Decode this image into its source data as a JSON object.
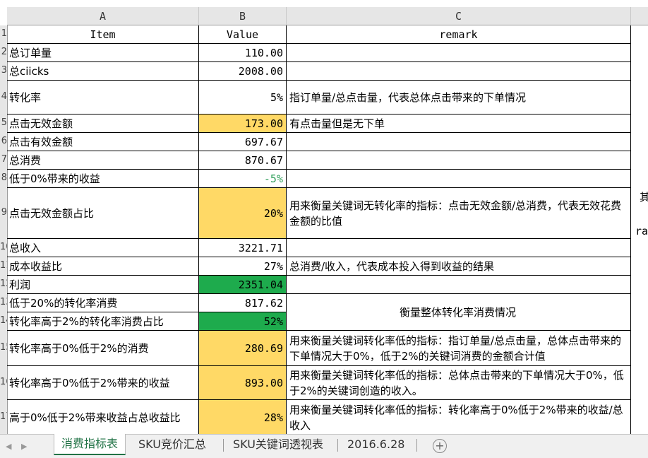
{
  "columns": [
    "A",
    "B",
    "C"
  ],
  "header": {
    "item": "Item",
    "value": "Value",
    "remark": "remark"
  },
  "rows": [
    {
      "item": "总订单量",
      "value": "110.00",
      "remark": ""
    },
    {
      "item": "总ciicks",
      "value": "2008.00",
      "remark": ""
    },
    {
      "item": "转化率",
      "value": "5%",
      "remark": "指订单量/总点击量，代表总体点击带来的下单情况"
    },
    {
      "item": "点击无效金额",
      "value": "173.00",
      "remark": "有点击量但是无下单",
      "fill": "#ffd966"
    },
    {
      "item": "点击有效金额",
      "value": "697.67",
      "remark": ""
    },
    {
      "item": "总消费",
      "value": "870.67",
      "remark": ""
    },
    {
      "item": "低于0%带来的收益",
      "value": "-5%",
      "remark": "",
      "value_color": "#2f9e5a"
    },
    {
      "item": "点击无效金额占比",
      "value": "20%",
      "remark": "用来衡量关键词无转化率的指标：点击无效金额/总消费，代表无效花费金额的比值",
      "fill": "#ffd966"
    },
    {
      "item": "总收入",
      "value": "3221.71",
      "remark": ""
    },
    {
      "item": "成本收益比",
      "value": "27%",
      "remark": "总消费/收入，代表成本投入得到收益的结果"
    },
    {
      "item": "利润",
      "value": "2351.04",
      "remark": "",
      "fill": "#1eab4d"
    },
    {
      "item": "低于20%的转化率消费",
      "value": "817.62",
      "remark": ""
    },
    {
      "item": "转化率高于2%的转化率消费占比",
      "value": "52%",
      "remark": "",
      "fill": "#1eab4d"
    },
    {
      "item": "转化率高于0%低于2%的消费",
      "value": "280.69",
      "remark": "用来衡量关键词转化率低的指标：指订单量/总点击量，总体点击带来的下单情况大于0%，低于2%的关键词消费的金额合计值",
      "fill": "#ffd966"
    },
    {
      "item": "转化率高于0%低于2%带来的收益",
      "value": "893.00",
      "remark": "用来衡量关键词转化率低的指标：总体点击带来的下单情况大于0%，低于2%的关键词创造的收入。",
      "fill": "#ffd966"
    },
    {
      "item": "高于0%低于2%带来收益占总收益比",
      "value": "28%",
      "remark": "用来衡量关键词转化率低的指标：转化率高于0%低于2%带来的收益/总收入",
      "fill": "#ffd966"
    }
  ],
  "merged_remark": "衡量整体转化率消费情况",
  "overflow_text": {
    "line1": "其",
    "line2": "ra"
  },
  "tabs": [
    "消费指标表",
    "SKU竞价汇总",
    "SKU关键词透视表",
    "2016.6.28"
  ],
  "active_tab": 0,
  "colors": {
    "accent": "#217346",
    "yellow_fill": "#ffd966",
    "green_fill": "#1eab4d",
    "negative_green_text": "#2f9e5a"
  }
}
